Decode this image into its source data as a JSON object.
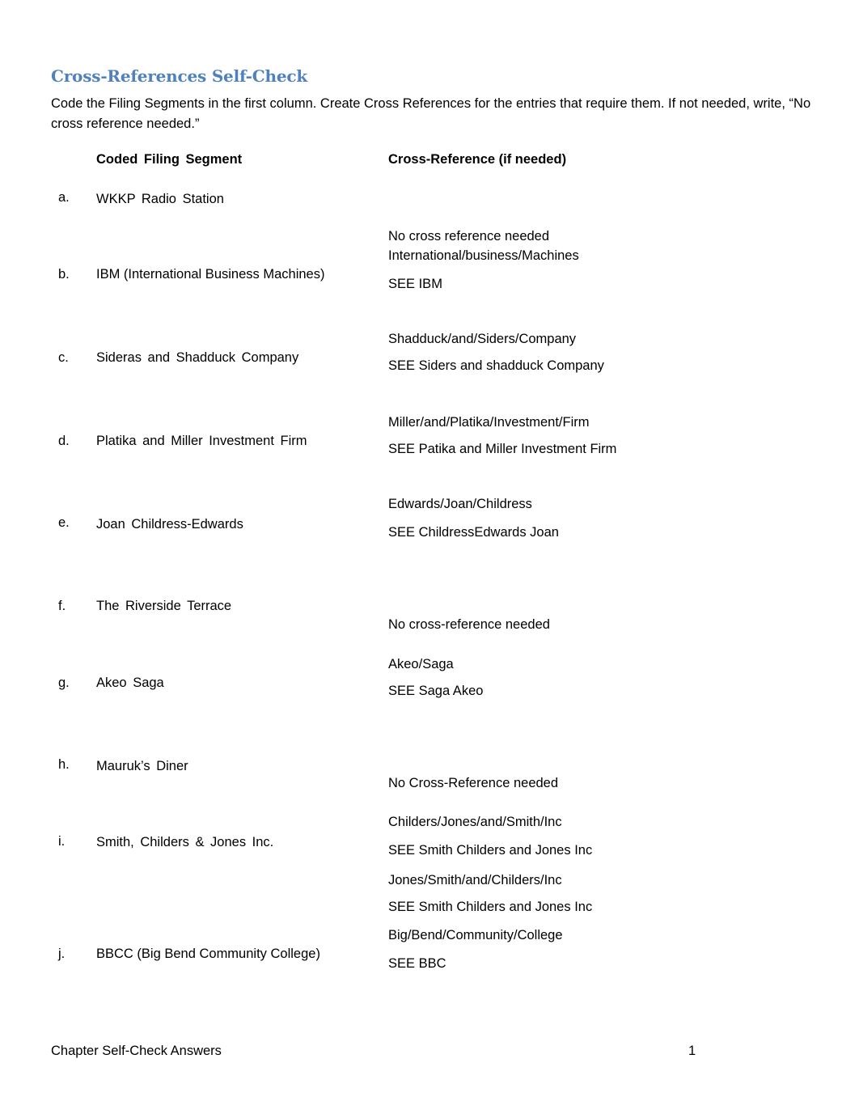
{
  "title": "Cross-References Self-Check",
  "instructions": "Code the Filing Segments in the first column.   Create Cross References for the entries that require them.  If not needed, write, “No cross reference needed.”",
  "table": {
    "headers": {
      "segment": "Coded Filing Segment",
      "cross_reference": "Cross-Reference (if needed)"
    },
    "rows": [
      {
        "marker": "a.",
        "segment": "WKKP  Radio  Station",
        "cross_references": []
      },
      {
        "marker": "b.",
        "segment": "IBM (International Business Machines)",
        "cross_references": [
          "No cross reference needed",
          "International/business/Machines",
          "SEE IBM"
        ]
      },
      {
        "marker": "c.",
        "segment": "Sideras  and  Shadduck  Company",
        "cross_references": [
          "Shadduck/and/Siders/Company",
          "SEE Siders and shadduck  Company"
        ]
      },
      {
        "marker": "d.",
        "segment": "Platika  and  Miller  Investment  Firm",
        "cross_references": [
          "Miller/and/Platika/Investment/Firm",
          "SEE Patika and Miller Investment Firm"
        ]
      },
      {
        "marker": "e.",
        "segment": "Joan  Childress-Edwards",
        "cross_references": [
          "Edwards/Joan/Childress",
          "SEE ChildressEdwards Joan"
        ]
      },
      {
        "marker": "f.",
        "segment": "The  Riverside  Terrace",
        "cross_references": [
          "No cross-reference needed"
        ]
      },
      {
        "marker": "g.",
        "segment": "Akeo  Saga",
        "cross_references": [
          "Akeo/Saga",
          "SEE Saga Akeo"
        ]
      },
      {
        "marker": "h.",
        "segment": "Mauruk’s  Diner",
        "cross_references": [
          "No Cross-Reference needed"
        ]
      },
      {
        "marker": "i.",
        "segment": "Smith,  Childers  &  Jones  Inc.",
        "cross_references": [
          "Childers/Jones/and/Smith/Inc",
          "SEE Smith Childers and Jones Inc",
          "Jones/Smith/and/Childers/Inc",
          "SEE Smith Childers and Jones Inc"
        ]
      },
      {
        "marker": "j.",
        "segment": "BBCC (Big Bend Community College)",
        "cross_references": [
          "Big/Bend/Community/College",
          "SEE BBC"
        ]
      }
    ]
  },
  "footer": {
    "left": "Chapter  Self-Check Answers",
    "page_number": "1"
  }
}
